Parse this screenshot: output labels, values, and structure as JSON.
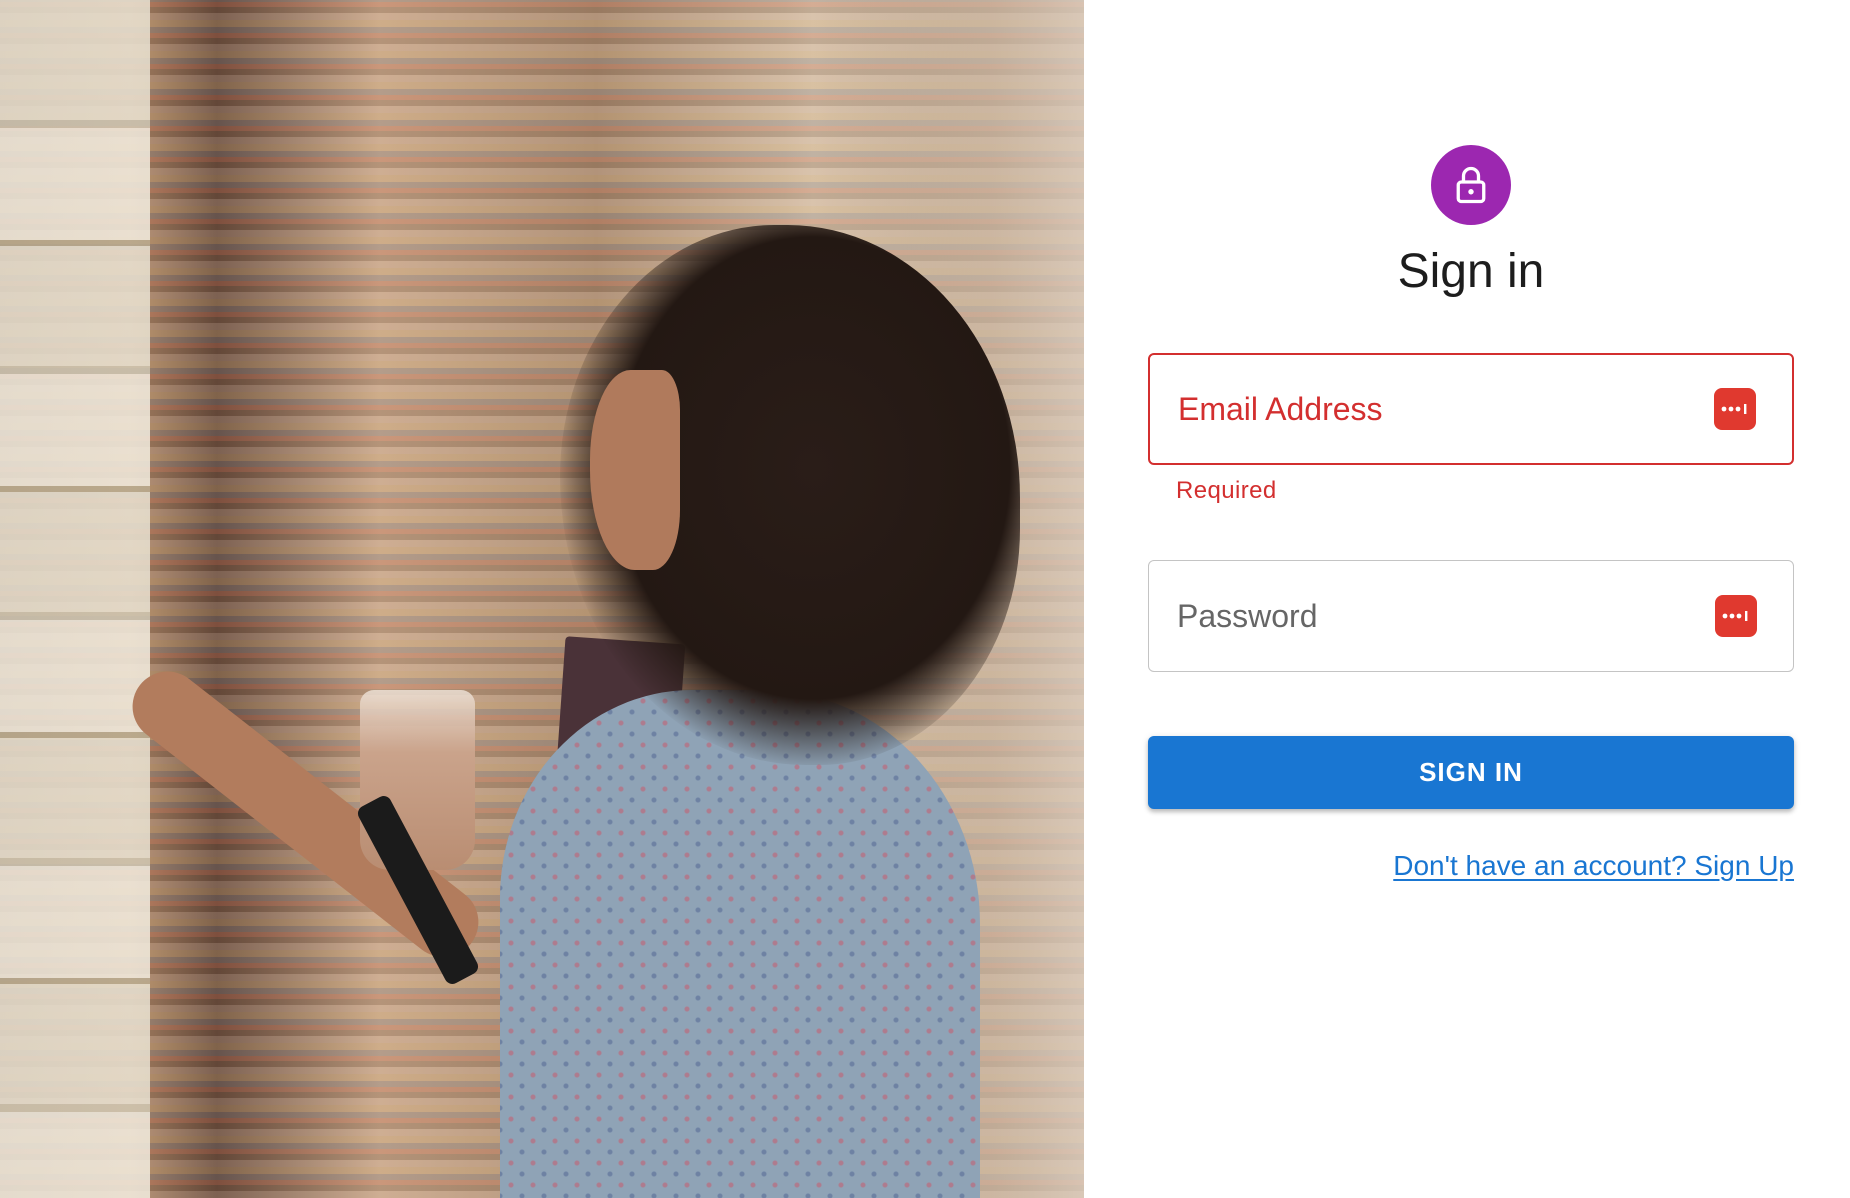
{
  "hero": {
    "alt": "Woman browsing books in a bookstore"
  },
  "header": {
    "title": "Sign in",
    "lock_icon": "lock-icon",
    "avatar_color": "#9c27b0"
  },
  "form": {
    "email": {
      "placeholder": "Email Address",
      "value": "",
      "helper_text": "Required",
      "error_color": "#d32f2f"
    },
    "password": {
      "placeholder": "Password",
      "value": ""
    },
    "password_manager_icon": "password-manager-icon",
    "submit_label": "SIGN IN",
    "submit_color": "#1976d2",
    "signup_link": "Don't have an account? Sign Up"
  }
}
